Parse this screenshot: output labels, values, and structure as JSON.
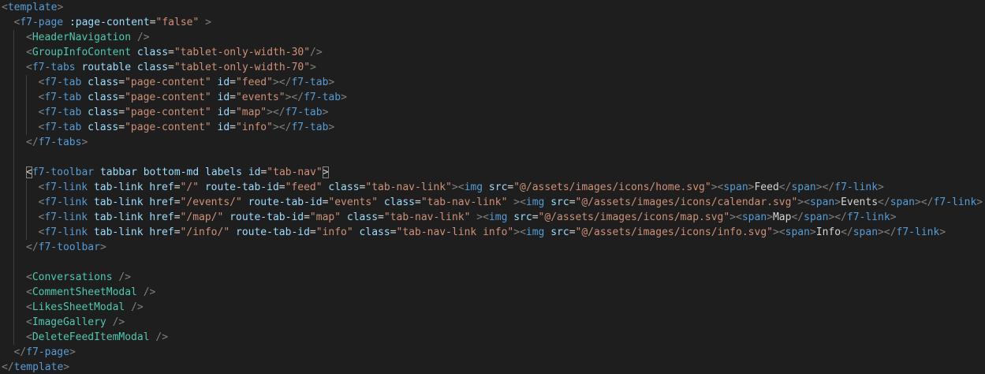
{
  "editor": {
    "lines": [
      {
        "indent": 0,
        "guides": 0,
        "tokens": [
          [
            "p",
            "<"
          ],
          [
            "t",
            "template"
          ],
          [
            "p",
            ">"
          ]
        ]
      },
      {
        "indent": 1,
        "guides": 0,
        "tokens": [
          [
            "p",
            "<"
          ],
          [
            "t",
            "f7-page"
          ],
          [
            "x",
            " "
          ],
          [
            "a",
            ":page-content"
          ],
          [
            "e",
            "="
          ],
          [
            "s",
            "\"false\""
          ],
          [
            "x",
            " "
          ],
          [
            "p",
            ">"
          ]
        ]
      },
      {
        "indent": 2,
        "guides": 1,
        "tokens": [
          [
            "p",
            "<"
          ],
          [
            "c",
            "HeaderNavigation"
          ],
          [
            "x",
            " "
          ],
          [
            "p",
            "/>"
          ]
        ]
      },
      {
        "indent": 2,
        "guides": 1,
        "tokens": [
          [
            "p",
            "<"
          ],
          [
            "c",
            "GroupInfoContent"
          ],
          [
            "x",
            " "
          ],
          [
            "a",
            "class"
          ],
          [
            "e",
            "="
          ],
          [
            "s",
            "\"tablet-only-width-30\""
          ],
          [
            "p",
            "/>"
          ]
        ]
      },
      {
        "indent": 2,
        "guides": 1,
        "tokens": [
          [
            "p",
            "<"
          ],
          [
            "t",
            "f7-tabs"
          ],
          [
            "x",
            " "
          ],
          [
            "a",
            "routable"
          ],
          [
            "x",
            " "
          ],
          [
            "a",
            "class"
          ],
          [
            "e",
            "="
          ],
          [
            "s",
            "\"tablet-only-width-70\""
          ],
          [
            "p",
            ">"
          ]
        ]
      },
      {
        "indent": 3,
        "guides": 2,
        "tokens": [
          [
            "p",
            "<"
          ],
          [
            "t",
            "f7-tab"
          ],
          [
            "x",
            " "
          ],
          [
            "a",
            "class"
          ],
          [
            "e",
            "="
          ],
          [
            "s",
            "\"page-content\""
          ],
          [
            "x",
            " "
          ],
          [
            "a",
            "id"
          ],
          [
            "e",
            "="
          ],
          [
            "s",
            "\"feed\""
          ],
          [
            "p",
            "></"
          ],
          [
            "t",
            "f7-tab"
          ],
          [
            "p",
            ">"
          ]
        ]
      },
      {
        "indent": 3,
        "guides": 2,
        "tokens": [
          [
            "p",
            "<"
          ],
          [
            "t",
            "f7-tab"
          ],
          [
            "x",
            " "
          ],
          [
            "a",
            "class"
          ],
          [
            "e",
            "="
          ],
          [
            "s",
            "\"page-content\""
          ],
          [
            "x",
            " "
          ],
          [
            "a",
            "id"
          ],
          [
            "e",
            "="
          ],
          [
            "s",
            "\"events\""
          ],
          [
            "p",
            "></"
          ],
          [
            "t",
            "f7-tab"
          ],
          [
            "p",
            ">"
          ]
        ]
      },
      {
        "indent": 3,
        "guides": 2,
        "tokens": [
          [
            "p",
            "<"
          ],
          [
            "t",
            "f7-tab"
          ],
          [
            "x",
            " "
          ],
          [
            "a",
            "class"
          ],
          [
            "e",
            "="
          ],
          [
            "s",
            "\"page-content\""
          ],
          [
            "x",
            " "
          ],
          [
            "a",
            "id"
          ],
          [
            "e",
            "="
          ],
          [
            "s",
            "\"map\""
          ],
          [
            "p",
            "></"
          ],
          [
            "t",
            "f7-tab"
          ],
          [
            "p",
            ">"
          ]
        ]
      },
      {
        "indent": 3,
        "guides": 2,
        "tokens": [
          [
            "p",
            "<"
          ],
          [
            "t",
            "f7-tab"
          ],
          [
            "x",
            " "
          ],
          [
            "a",
            "class"
          ],
          [
            "e",
            "="
          ],
          [
            "s",
            "\"page-content\""
          ],
          [
            "x",
            " "
          ],
          [
            "a",
            "id"
          ],
          [
            "e",
            "="
          ],
          [
            "s",
            "\"info\""
          ],
          [
            "p",
            "></"
          ],
          [
            "t",
            "f7-tab"
          ],
          [
            "p",
            ">"
          ]
        ]
      },
      {
        "indent": 2,
        "guides": 1,
        "tokens": [
          [
            "p",
            "</"
          ],
          [
            "t",
            "f7-tabs"
          ],
          [
            "p",
            ">"
          ]
        ]
      },
      {
        "indent": 0,
        "guides": 1,
        "tokens": []
      },
      {
        "indent": 2,
        "guides": 1,
        "tokens": [
          [
            "b",
            "<"
          ],
          [
            "t",
            "f7-toolbar"
          ],
          [
            "x",
            " "
          ],
          [
            "a",
            "tabbar"
          ],
          [
            "x",
            " "
          ],
          [
            "a",
            "bottom-md"
          ],
          [
            "x",
            " "
          ],
          [
            "a",
            "labels"
          ],
          [
            "x",
            " "
          ],
          [
            "a",
            "id"
          ],
          [
            "e",
            "="
          ],
          [
            "s",
            "\"tab-nav\""
          ],
          [
            "b",
            ">"
          ]
        ]
      },
      {
        "indent": 3,
        "guides": 2,
        "tokens": [
          [
            "p",
            "<"
          ],
          [
            "t",
            "f7-link"
          ],
          [
            "x",
            " "
          ],
          [
            "a",
            "tab-link"
          ],
          [
            "x",
            " "
          ],
          [
            "a",
            "href"
          ],
          [
            "e",
            "="
          ],
          [
            "s",
            "\"/\""
          ],
          [
            "x",
            " "
          ],
          [
            "a",
            "route-tab-id"
          ],
          [
            "e",
            "="
          ],
          [
            "s",
            "\"feed\""
          ],
          [
            "x",
            " "
          ],
          [
            "a",
            "class"
          ],
          [
            "e",
            "="
          ],
          [
            "s",
            "\"tab-nav-link\""
          ],
          [
            "p",
            ">"
          ],
          [
            "p",
            "<"
          ],
          [
            "t",
            "img"
          ],
          [
            "x",
            " "
          ],
          [
            "a",
            "src"
          ],
          [
            "e",
            "="
          ],
          [
            "s",
            "\"@/assets/images/icons/home.svg\""
          ],
          [
            "p",
            ">"
          ],
          [
            "p",
            "<"
          ],
          [
            "t",
            "span"
          ],
          [
            "p",
            ">"
          ],
          [
            "x",
            "Feed"
          ],
          [
            "p",
            "</"
          ],
          [
            "t",
            "span"
          ],
          [
            "p",
            "></"
          ],
          [
            "t",
            "f7-link"
          ],
          [
            "p",
            ">"
          ]
        ]
      },
      {
        "indent": 3,
        "guides": 2,
        "tokens": [
          [
            "p",
            "<"
          ],
          [
            "t",
            "f7-link"
          ],
          [
            "x",
            " "
          ],
          [
            "a",
            "tab-link"
          ],
          [
            "x",
            " "
          ],
          [
            "a",
            "href"
          ],
          [
            "e",
            "="
          ],
          [
            "s",
            "\"/events/\""
          ],
          [
            "x",
            " "
          ],
          [
            "a",
            "route-tab-id"
          ],
          [
            "e",
            "="
          ],
          [
            "s",
            "\"events\""
          ],
          [
            "x",
            " "
          ],
          [
            "a",
            "class"
          ],
          [
            "e",
            "="
          ],
          [
            "s",
            "\"tab-nav-link\""
          ],
          [
            "x",
            " "
          ],
          [
            "p",
            ">"
          ],
          [
            "p",
            "<"
          ],
          [
            "t",
            "img"
          ],
          [
            "x",
            " "
          ],
          [
            "a",
            "src"
          ],
          [
            "e",
            "="
          ],
          [
            "s",
            "\"@/assets/images/icons/calendar.svg\""
          ],
          [
            "p",
            ">"
          ],
          [
            "p",
            "<"
          ],
          [
            "t",
            "span"
          ],
          [
            "p",
            ">"
          ],
          [
            "x",
            "Events"
          ],
          [
            "p",
            "</"
          ],
          [
            "t",
            "span"
          ],
          [
            "p",
            "></"
          ],
          [
            "t",
            "f7-link"
          ],
          [
            "p",
            ">"
          ]
        ]
      },
      {
        "indent": 3,
        "guides": 2,
        "tokens": [
          [
            "p",
            "<"
          ],
          [
            "t",
            "f7-link"
          ],
          [
            "x",
            " "
          ],
          [
            "a",
            "tab-link"
          ],
          [
            "x",
            " "
          ],
          [
            "a",
            "href"
          ],
          [
            "e",
            "="
          ],
          [
            "s",
            "\"/map/\""
          ],
          [
            "x",
            " "
          ],
          [
            "a",
            "route-tab-id"
          ],
          [
            "e",
            "="
          ],
          [
            "s",
            "\"map\""
          ],
          [
            "x",
            " "
          ],
          [
            "a",
            "class"
          ],
          [
            "e",
            "="
          ],
          [
            "s",
            "\"tab-nav-link\""
          ],
          [
            "x",
            " "
          ],
          [
            "p",
            ">"
          ],
          [
            "p",
            "<"
          ],
          [
            "t",
            "img"
          ],
          [
            "x",
            " "
          ],
          [
            "a",
            "src"
          ],
          [
            "e",
            "="
          ],
          [
            "s",
            "\"@/assets/images/icons/map.svg\""
          ],
          [
            "p",
            ">"
          ],
          [
            "p",
            "<"
          ],
          [
            "t",
            "span"
          ],
          [
            "p",
            ">"
          ],
          [
            "x",
            "Map"
          ],
          [
            "p",
            "</"
          ],
          [
            "t",
            "span"
          ],
          [
            "p",
            "></"
          ],
          [
            "t",
            "f7-link"
          ],
          [
            "p",
            ">"
          ]
        ]
      },
      {
        "indent": 3,
        "guides": 2,
        "tokens": [
          [
            "p",
            "<"
          ],
          [
            "t",
            "f7-link"
          ],
          [
            "x",
            " "
          ],
          [
            "a",
            "tab-link"
          ],
          [
            "x",
            " "
          ],
          [
            "a",
            "href"
          ],
          [
            "e",
            "="
          ],
          [
            "s",
            "\"/info/\""
          ],
          [
            "x",
            " "
          ],
          [
            "a",
            "route-tab-id"
          ],
          [
            "e",
            "="
          ],
          [
            "s",
            "\"info\""
          ],
          [
            "x",
            " "
          ],
          [
            "a",
            "class"
          ],
          [
            "e",
            "="
          ],
          [
            "s",
            "\"tab-nav-link info\""
          ],
          [
            "p",
            ">"
          ],
          [
            "p",
            "<"
          ],
          [
            "t",
            "img"
          ],
          [
            "x",
            " "
          ],
          [
            "a",
            "src"
          ],
          [
            "e",
            "="
          ],
          [
            "s",
            "\"@/assets/images/icons/info.svg\""
          ],
          [
            "p",
            ">"
          ],
          [
            "p",
            "<"
          ],
          [
            "t",
            "span"
          ],
          [
            "p",
            ">"
          ],
          [
            "x",
            "Info"
          ],
          [
            "p",
            "</"
          ],
          [
            "t",
            "span"
          ],
          [
            "p",
            "></"
          ],
          [
            "t",
            "f7-link"
          ],
          [
            "p",
            ">"
          ]
        ]
      },
      {
        "indent": 2,
        "guides": 1,
        "tokens": [
          [
            "p",
            "</"
          ],
          [
            "t",
            "f7-toolbar"
          ],
          [
            "p",
            ">"
          ]
        ]
      },
      {
        "indent": 0,
        "guides": 1,
        "tokens": []
      },
      {
        "indent": 2,
        "guides": 1,
        "tokens": [
          [
            "p",
            "<"
          ],
          [
            "c",
            "Conversations"
          ],
          [
            "x",
            " "
          ],
          [
            "p",
            "/>"
          ]
        ]
      },
      {
        "indent": 2,
        "guides": 1,
        "tokens": [
          [
            "p",
            "<"
          ],
          [
            "c",
            "CommentSheetModal"
          ],
          [
            "x",
            " "
          ],
          [
            "p",
            "/>"
          ]
        ]
      },
      {
        "indent": 2,
        "guides": 1,
        "tokens": [
          [
            "p",
            "<"
          ],
          [
            "c",
            "LikesSheetModal"
          ],
          [
            "x",
            " "
          ],
          [
            "p",
            "/>"
          ]
        ]
      },
      {
        "indent": 2,
        "guides": 1,
        "tokens": [
          [
            "p",
            "<"
          ],
          [
            "c",
            "ImageGallery"
          ],
          [
            "x",
            " "
          ],
          [
            "p",
            "/>"
          ]
        ]
      },
      {
        "indent": 2,
        "guides": 1,
        "tokens": [
          [
            "p",
            "<"
          ],
          [
            "c",
            "DeleteFeedItemModal"
          ],
          [
            "x",
            " "
          ],
          [
            "p",
            "/>"
          ]
        ]
      },
      {
        "indent": 1,
        "guides": 0,
        "tokens": [
          [
            "p",
            "</"
          ],
          [
            "t",
            "f7-page"
          ],
          [
            "p",
            ">"
          ]
        ]
      },
      {
        "indent": 0,
        "guides": 0,
        "tokens": [
          [
            "p",
            "</"
          ],
          [
            "t",
            "template"
          ],
          [
            "p",
            ">"
          ]
        ]
      }
    ]
  },
  "colors": {
    "background": "#1e1e1e",
    "punctuation": "#808080",
    "tag": "#569cd6",
    "component": "#4ec9b0",
    "attribute": "#9cdcfe",
    "string": "#ce9178",
    "text": "#d4d4d4"
  }
}
